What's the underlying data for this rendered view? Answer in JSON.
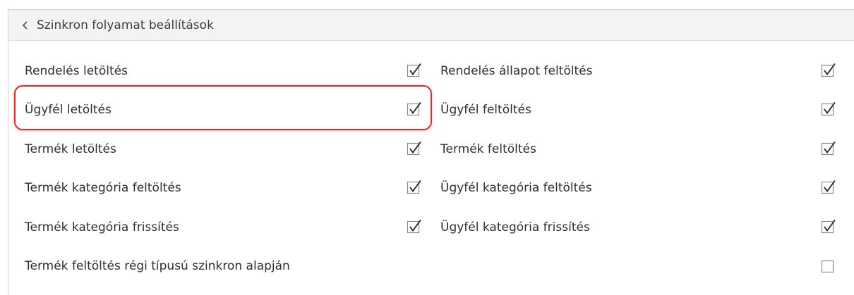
{
  "panel": {
    "title": "Szinkron folyamat beállítások",
    "collapse_icon": "chevron-left-icon"
  },
  "options": [
    {
      "id": "rendeles-letoltes",
      "label": "Rendelés letöltés",
      "checked": true
    },
    {
      "id": "rendeles-allapot-feltoltes",
      "label": "Rendelés állapot feltöltés",
      "checked": true
    },
    {
      "id": "ugyfel-letoltes",
      "label": "Ügyfél letöltés",
      "checked": true
    },
    {
      "id": "ugyfel-feltoltes",
      "label": "Ügyfél feltöltés",
      "checked": true
    },
    {
      "id": "termek-letoltes",
      "label": "Termék letöltés",
      "checked": true
    },
    {
      "id": "termek-feltoltes",
      "label": "Termék feltöltés",
      "checked": true
    },
    {
      "id": "termek-kategoria-feltoltes",
      "label": "Termék kategória feltöltés",
      "checked": true
    },
    {
      "id": "ugyfel-kategoria-feltoltes",
      "label": "Ügyfél kategória feltöltés",
      "checked": true
    },
    {
      "id": "termek-kategoria-frissites",
      "label": "Termék kategória frissítés",
      "checked": true
    },
    {
      "id": "ugyfel-kategoria-frissites",
      "label": "Ügyfél kategória frissítés",
      "checked": true
    },
    {
      "id": "termek-feltoltes-regi-tipusu",
      "label": "Termék feltöltés régi típusú szinkron alapján",
      "checked": false
    }
  ],
  "highlight": {
    "target": "ugyfel-letoltes",
    "color": "#e8262b"
  }
}
